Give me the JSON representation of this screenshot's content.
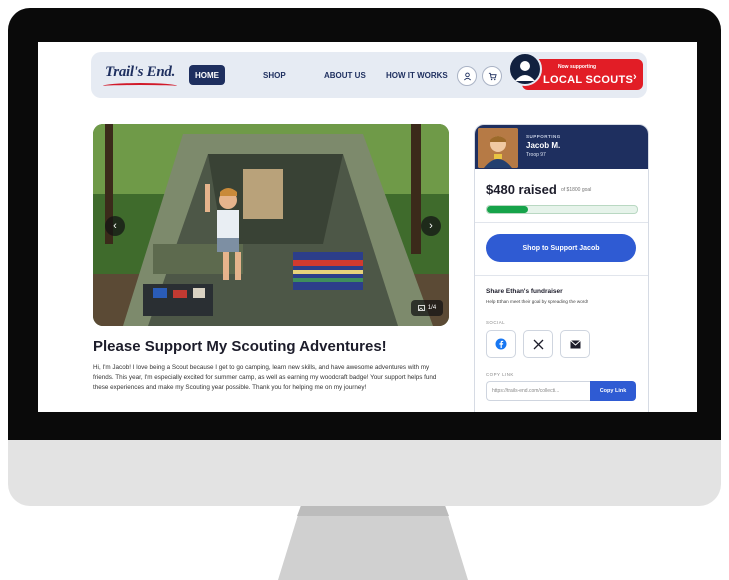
{
  "nav": {
    "logo": "Trail's End.",
    "home": "HOME",
    "shop": "SHOP",
    "about": "ABOUT US",
    "how": "HOW IT WORKS",
    "account_icon": "user-icon",
    "cart_icon": "cart-icon",
    "supporting_small": "Now supporting",
    "supporting_big": "LOCAL SCOUTS",
    "supporting_chevron": "›"
  },
  "hero": {
    "prev": "‹",
    "next": "›",
    "counter": "1/4"
  },
  "main": {
    "title": "Please Support My Scouting Adventures!",
    "body": "Hi, I'm Jacob! I love being a Scout because I get to go camping, learn new skills, and have awesome adventures with my friends. This year, I'm especially excited for summer camp, as well as earning my woodcraft badge! Your support helps fund these experiences and make my Scouting year possible. Thank you for helping me on my journey!"
  },
  "card": {
    "supporting_label": "SUPPORTING",
    "scout_name": "Jacob M.",
    "troop": "Troop 97",
    "raised": "$480 raised",
    "goal": "of $1800 goal",
    "progress_fraction": 0.27,
    "shop_button": "Shop to Support Jacob",
    "share_title": "Share Ethan's fundraiser",
    "share_sub": "Help Ethan meet their goal by spreading the word!",
    "social_label": "SOCIAL",
    "copy_label": "COPY LINK",
    "copy_url": "https://trails-end.com/collecti...",
    "copy_button": "Copy Link"
  },
  "colors": {
    "navy": "#1e2f5f",
    "brand_red": "#e21d26",
    "primary_blue": "#2f5bd3",
    "progress_green": "#16a34a"
  }
}
